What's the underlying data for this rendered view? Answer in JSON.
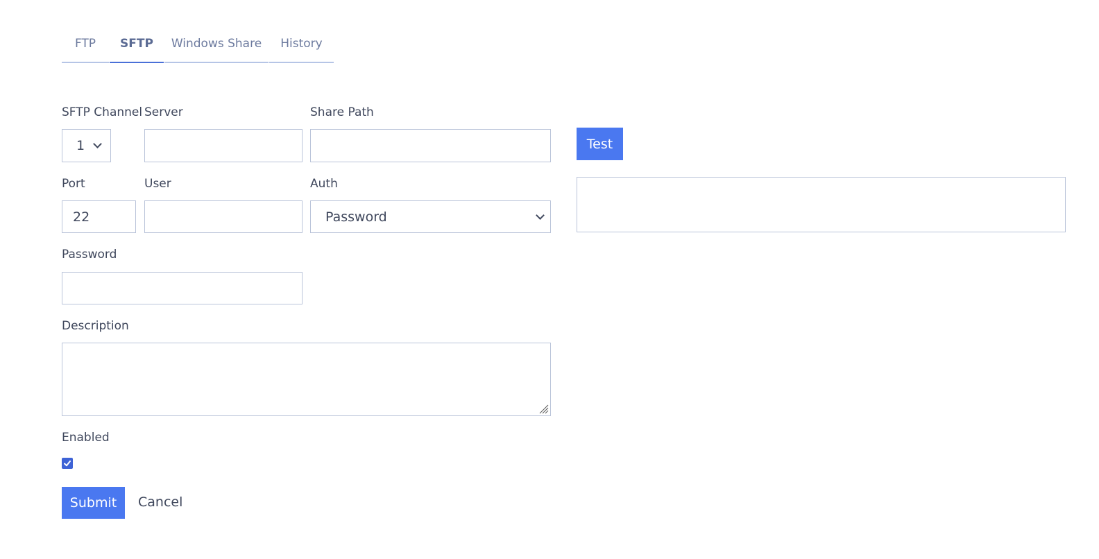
{
  "tabs": [
    {
      "label": "FTP"
    },
    {
      "label": "SFTP",
      "active": true
    },
    {
      "label": "Windows Share"
    },
    {
      "label": "History"
    }
  ],
  "form": {
    "sftp_channel": {
      "label": "SFTP Channel",
      "value": "1"
    },
    "server": {
      "label": "Server",
      "value": ""
    },
    "share_path": {
      "label": "Share Path",
      "value": ""
    },
    "port": {
      "label": "Port",
      "value": "22"
    },
    "user": {
      "label": "User",
      "value": ""
    },
    "auth": {
      "label": "Auth",
      "value": "Password"
    },
    "password": {
      "label": "Password",
      "value": ""
    },
    "description": {
      "label": "Description",
      "value": ""
    },
    "enabled": {
      "label": "Enabled",
      "checked": true
    }
  },
  "test_button": {
    "label": "Test"
  },
  "test_output": {
    "value": ""
  },
  "actions": {
    "submit_label": "Submit",
    "cancel_label": "Cancel"
  },
  "colors": {
    "primary": "#4a78f0",
    "active_tab_underline": "#4a70d8",
    "checkbox": "#3e63d6",
    "border": "#b9c3d9"
  }
}
